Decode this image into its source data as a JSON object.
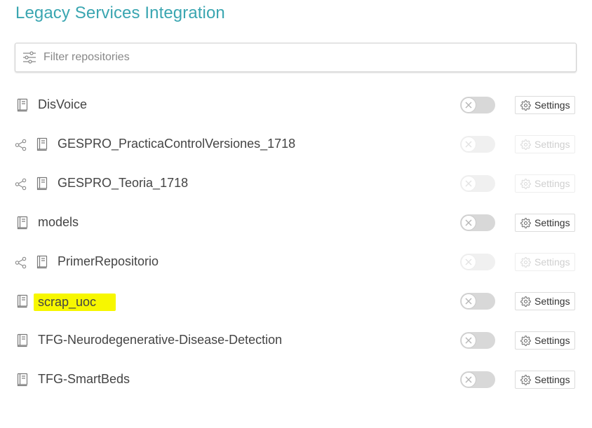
{
  "page": {
    "title": "Legacy Services Integration"
  },
  "filter": {
    "placeholder": "Filter repositories",
    "value": ""
  },
  "repositories": [
    {
      "name": "DisVoice",
      "shared": false,
      "enabled": false,
      "disabled": false,
      "highlighted": false,
      "settings_label": "Settings"
    },
    {
      "name": "GESPRO_PracticaControlVersiones_1718",
      "shared": true,
      "enabled": false,
      "disabled": true,
      "highlighted": false,
      "settings_label": "Settings"
    },
    {
      "name": "GESPRO_Teoria_1718",
      "shared": true,
      "enabled": false,
      "disabled": true,
      "highlighted": false,
      "settings_label": "Settings"
    },
    {
      "name": "models",
      "shared": false,
      "enabled": false,
      "disabled": false,
      "highlighted": false,
      "settings_label": "Settings"
    },
    {
      "name": "PrimerRepositorio",
      "shared": true,
      "enabled": false,
      "disabled": true,
      "highlighted": false,
      "settings_label": "Settings"
    },
    {
      "name": "scrap_uoc",
      "shared": false,
      "enabled": false,
      "disabled": false,
      "highlighted": true,
      "settings_label": "Settings"
    },
    {
      "name": "TFG-Neurodegenerative-Disease-Detection",
      "shared": false,
      "enabled": false,
      "disabled": false,
      "highlighted": false,
      "settings_label": "Settings"
    },
    {
      "name": "TFG-SmartBeds",
      "shared": false,
      "enabled": false,
      "disabled": false,
      "highlighted": false,
      "settings_label": "Settings"
    }
  ],
  "icons": {
    "filter": "sliders-icon",
    "repo": "book-icon",
    "shared": "share-icon",
    "toggle_off": "close-icon",
    "settings": "gear-icon"
  },
  "colors": {
    "title": "#3aa6b1",
    "highlight": "#f7f700",
    "toggle_track": "#d8d8d8",
    "toggle_track_disabled": "#f0f0f0"
  }
}
